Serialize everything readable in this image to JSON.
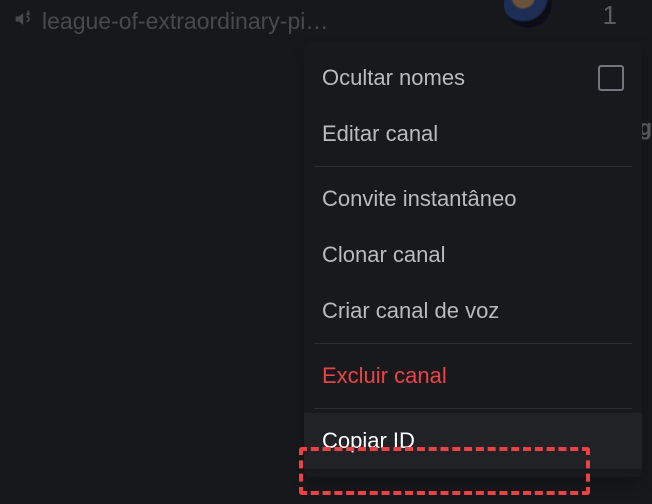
{
  "channel": {
    "name": "league-of-extraordinary-pi…"
  },
  "badge": {
    "count": "1"
  },
  "side": {
    "letter": "g"
  },
  "menu": {
    "hide_names": "Ocultar nomes",
    "edit_channel": "Editar canal",
    "instant_invite": "Convite instantâneo",
    "clone_channel": "Clonar canal",
    "create_voice": "Criar canal de voz",
    "delete_channel": "Excluir canal",
    "copy_id": "Copiar ID"
  }
}
